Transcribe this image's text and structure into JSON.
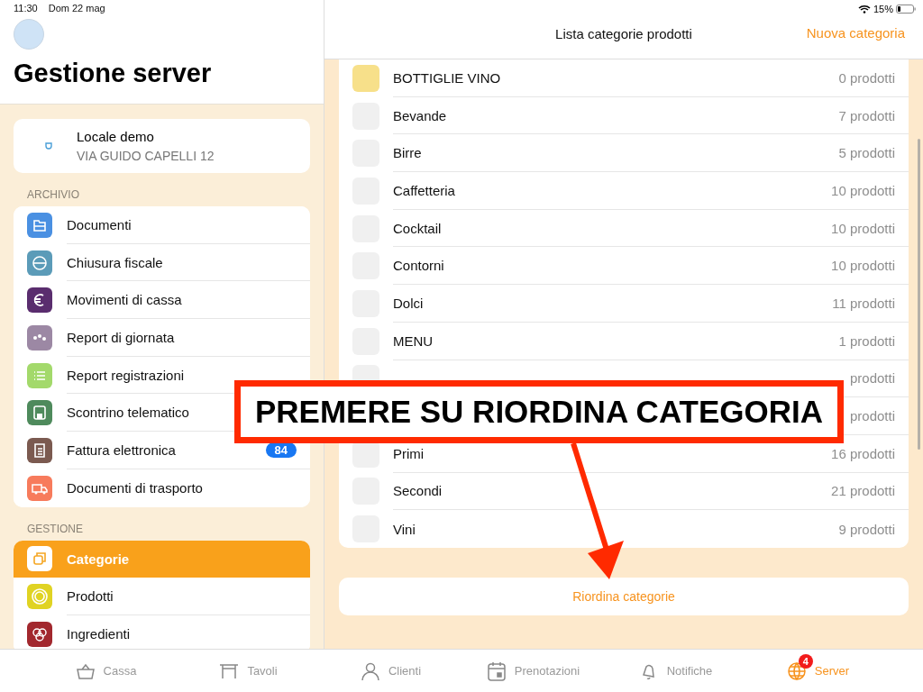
{
  "status_bar": {
    "time": "11:30",
    "date": "Dom 22 mag",
    "battery": "15%"
  },
  "sidebar": {
    "title": "Gestione server",
    "venue": {
      "name": "Locale demo",
      "address": "VIA GUIDO CAPELLI 12"
    },
    "sections": [
      {
        "heading": "ARCHIVIO",
        "items": [
          {
            "label": "Documenti",
            "kind": "folder",
            "color": "#4a90e2",
            "selected": false
          },
          {
            "label": "Chiusura fiscale",
            "kind": "minus",
            "color": "#5b9bb8",
            "selected": false
          },
          {
            "label": "Movimenti di cassa",
            "kind": "euro",
            "color": "#5a2d6e",
            "selected": false
          },
          {
            "label": "Report di giornata",
            "kind": "dots",
            "color": "#9c88a4",
            "selected": false
          },
          {
            "label": "Report registrazioni",
            "kind": "list",
            "color": "#a3d96b",
            "selected": false
          },
          {
            "label": "Scontrino telematico",
            "kind": "printer",
            "color": "#4e8a5c",
            "selected": false
          },
          {
            "label": "Fattura elettronica",
            "kind": "document",
            "color": "#7b5a50",
            "selected": false,
            "badge": "84"
          },
          {
            "label": "Documenti di trasporto",
            "kind": "truck",
            "color": "#f77b5c",
            "selected": false
          }
        ]
      },
      {
        "heading": "GESTIONE",
        "items": [
          {
            "label": "Categorie",
            "kind": "squares",
            "color": "#ffffff",
            "selected": true
          },
          {
            "label": "Prodotti",
            "kind": "ring",
            "color": "#e0d323",
            "selected": false
          },
          {
            "label": "Ingredienti",
            "kind": "circles",
            "color": "#a2282e",
            "selected": false
          }
        ]
      }
    ]
  },
  "header": {
    "title": "Lista categorie prodotti",
    "action": "Nuova categoria"
  },
  "categories": [
    {
      "name": "BOTTIGLIE VINO",
      "count": "0 prodotti",
      "color": "#f7e08a"
    },
    {
      "name": "Bevande",
      "count": "7 prodotti",
      "color": "#f0f0f0"
    },
    {
      "name": "Birre",
      "count": "5 prodotti",
      "color": "#f0f0f0"
    },
    {
      "name": "Caffetteria",
      "count": "10 prodotti",
      "color": "#f0f0f0"
    },
    {
      "name": "Cocktail",
      "count": "10 prodotti",
      "color": "#f0f0f0"
    },
    {
      "name": "Contorni",
      "count": "10 prodotti",
      "color": "#f0f0f0"
    },
    {
      "name": "Dolci",
      "count": "11 prodotti",
      "color": "#f0f0f0"
    },
    {
      "name": "MENU",
      "count": "1 prodotti",
      "color": "#f0f0f0"
    },
    {
      "count": "prodotti",
      "color": "#f0f0f0"
    },
    {
      "count": "prodotti"
    },
    {
      "name": "Primi",
      "count": "16 prodotti",
      "color": "#f0f0f0"
    },
    {
      "name": "Secondi",
      "count": "21 prodotti",
      "color": "#f0f0f0"
    },
    {
      "name": "Vini",
      "count": "9 prodotti",
      "color": "#f0f0f0"
    }
  ],
  "reorder_button": "Riordina categorie",
  "tab_bar": [
    {
      "label": "Cassa",
      "kind": "basket",
      "selected": false
    },
    {
      "label": "Tavoli",
      "kind": "table",
      "selected": false
    },
    {
      "label": "Clienti",
      "kind": "person",
      "selected": false
    },
    {
      "label": "Prenotazioni",
      "kind": "calendar",
      "selected": false
    },
    {
      "label": "Notifiche",
      "kind": "bell",
      "selected": false
    },
    {
      "label": "Server",
      "kind": "globe",
      "selected": true,
      "badge": "4"
    }
  ],
  "annotation": {
    "text": "PREMERE SU RIORDINA CATEGORIA"
  }
}
